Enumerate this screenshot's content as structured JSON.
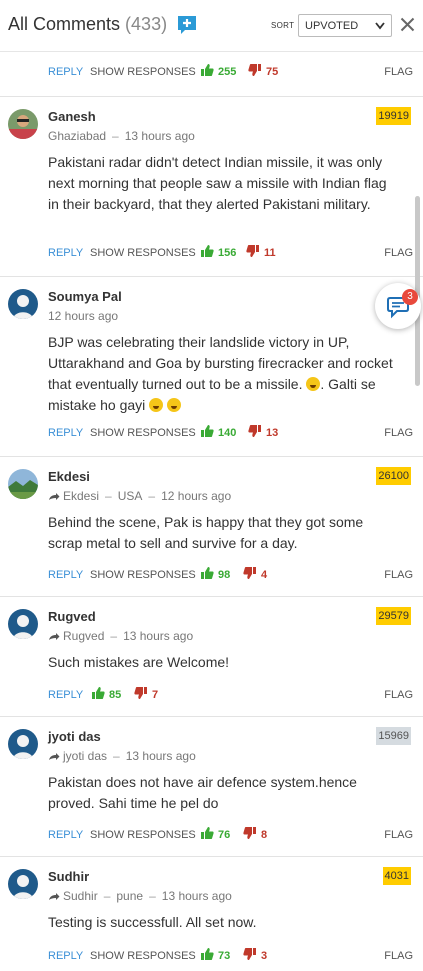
{
  "header": {
    "title": "All Comments",
    "count": "(433)",
    "add_icon": "add-comment-icon",
    "sort_label": "SORT",
    "sort_value": "UPVOTED",
    "close_icon": "close-icon"
  },
  "top_actions": {
    "reply": "REPLY",
    "show_responses": "SHOW RESPONSES",
    "up": "255",
    "down": "75",
    "flag": "FLAG"
  },
  "notification": {
    "badge": "3"
  },
  "colors": {
    "link": "#3a8fd6",
    "upvote": "#3aaa35",
    "downvote": "#c0392b",
    "points": "#ffcc00"
  },
  "comments": [
    {
      "author": "Ganesh",
      "location": "Ghaziabad",
      "time": "13 hours ago",
      "points": "19919",
      "text": "Pakistani radar didn't detect Indian missile, it was only next morning that people saw a missile with Indian flag in their backyard, that they alerted Pakistani military.",
      "reply": "REPLY",
      "show_responses": "SHOW RESPONSES",
      "up": "156",
      "down": "11",
      "flag": "FLAG"
    },
    {
      "author": "Soumya Pal",
      "time": "12 hours ago",
      "text": "BJP was celebrating their landslide victory in UP, Uttarakhand and Goa by bursting firecracker and rocket that eventually turned out to be a missile.",
      "text_tail": "Galti se mistake ho gayi",
      "reply": "REPLY",
      "show_responses": "SHOW RESPONSES",
      "up": "140",
      "down": "13",
      "flag": "FLAG"
    },
    {
      "author": "Ekdesi",
      "shared_by": "Ekdesi",
      "location": "USA",
      "time": "12 hours ago",
      "points": "26100",
      "text": "Behind the scene, Pak is happy that they got some scrap metal to sell and survive for a day.",
      "reply": "REPLY",
      "show_responses": "SHOW RESPONSES",
      "up": "98",
      "down": "4",
      "flag": "FLAG"
    },
    {
      "author": "Rugved",
      "shared_by": "Rugved",
      "time": "13 hours ago",
      "points": "29579",
      "text": "Such mistakes are Welcome!",
      "reply": "REPLY",
      "up": "85",
      "down": "7",
      "flag": "FLAG"
    },
    {
      "author": "jyoti das",
      "shared_by": "jyoti das",
      "time": "13 hours ago",
      "points": "15969",
      "text": "Pakistan does not have air defence system.hence proved. Sahi time he pel do",
      "reply": "REPLY",
      "show_responses": "SHOW RESPONSES",
      "up": "76",
      "down": "8",
      "flag": "FLAG"
    },
    {
      "author": "Sudhir",
      "shared_by": "Sudhir",
      "location": "pune",
      "time": "13 hours ago",
      "points": "4031",
      "text": "Testing is successfull. All set now.",
      "reply": "REPLY",
      "show_responses": "SHOW RESPONSES",
      "up": "73",
      "down": "3",
      "flag": "FLAG"
    }
  ]
}
